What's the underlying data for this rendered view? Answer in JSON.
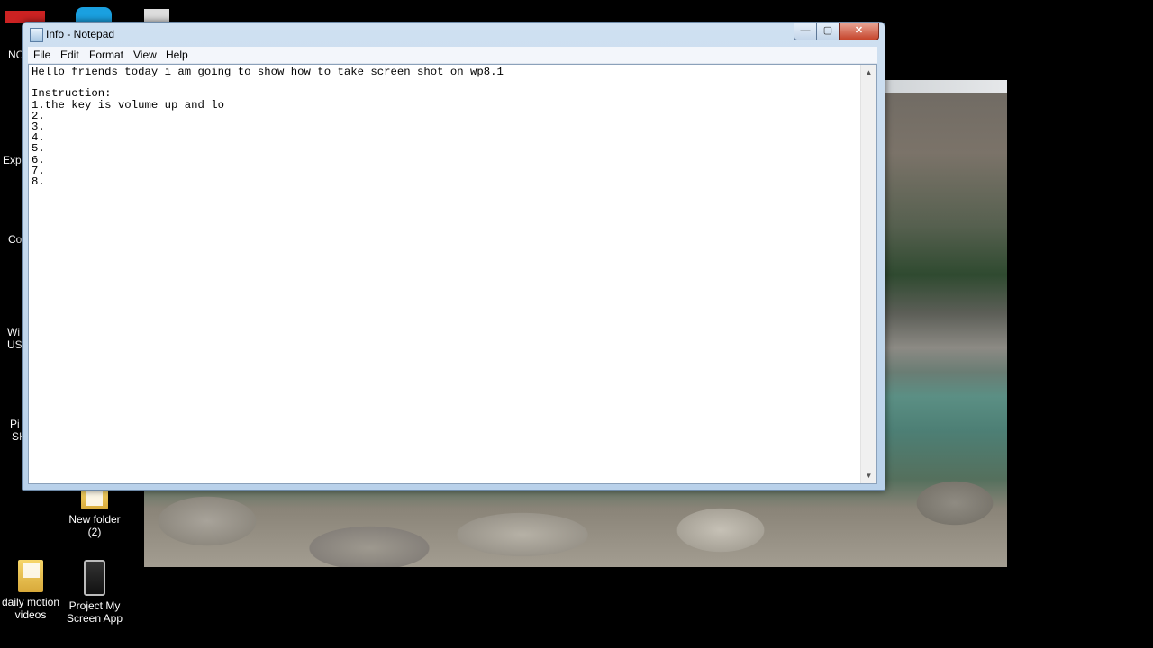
{
  "window": {
    "title": "Info - Notepad",
    "controls": {
      "minimize": "—",
      "maximize": "▢",
      "close": "✕"
    }
  },
  "menu": [
    "File",
    "Edit",
    "Format",
    "View",
    "Help"
  ],
  "editor": {
    "content": "Hello friends today i am going to show how to take screen shot on wp8.1\n\nInstruction:\n1.the key is volume up and lo\n2.\n3.\n4.\n5.\n6.\n7.\n8."
  },
  "desktop": {
    "icons": [
      {
        "label": "New folder\n(2)",
        "icon": "folder-icon"
      },
      {
        "label": "daily motion\nvideos",
        "icon": "folder-icon"
      },
      {
        "label": "Project My\nScreen App",
        "icon": "phone-app-icon"
      }
    ],
    "edge_fragments": [
      "NC",
      "Expe",
      "Co",
      "Wi",
      "US",
      "Pi",
      "SH"
    ]
  },
  "scrollbar": {
    "up": "▲",
    "down": "▼"
  }
}
